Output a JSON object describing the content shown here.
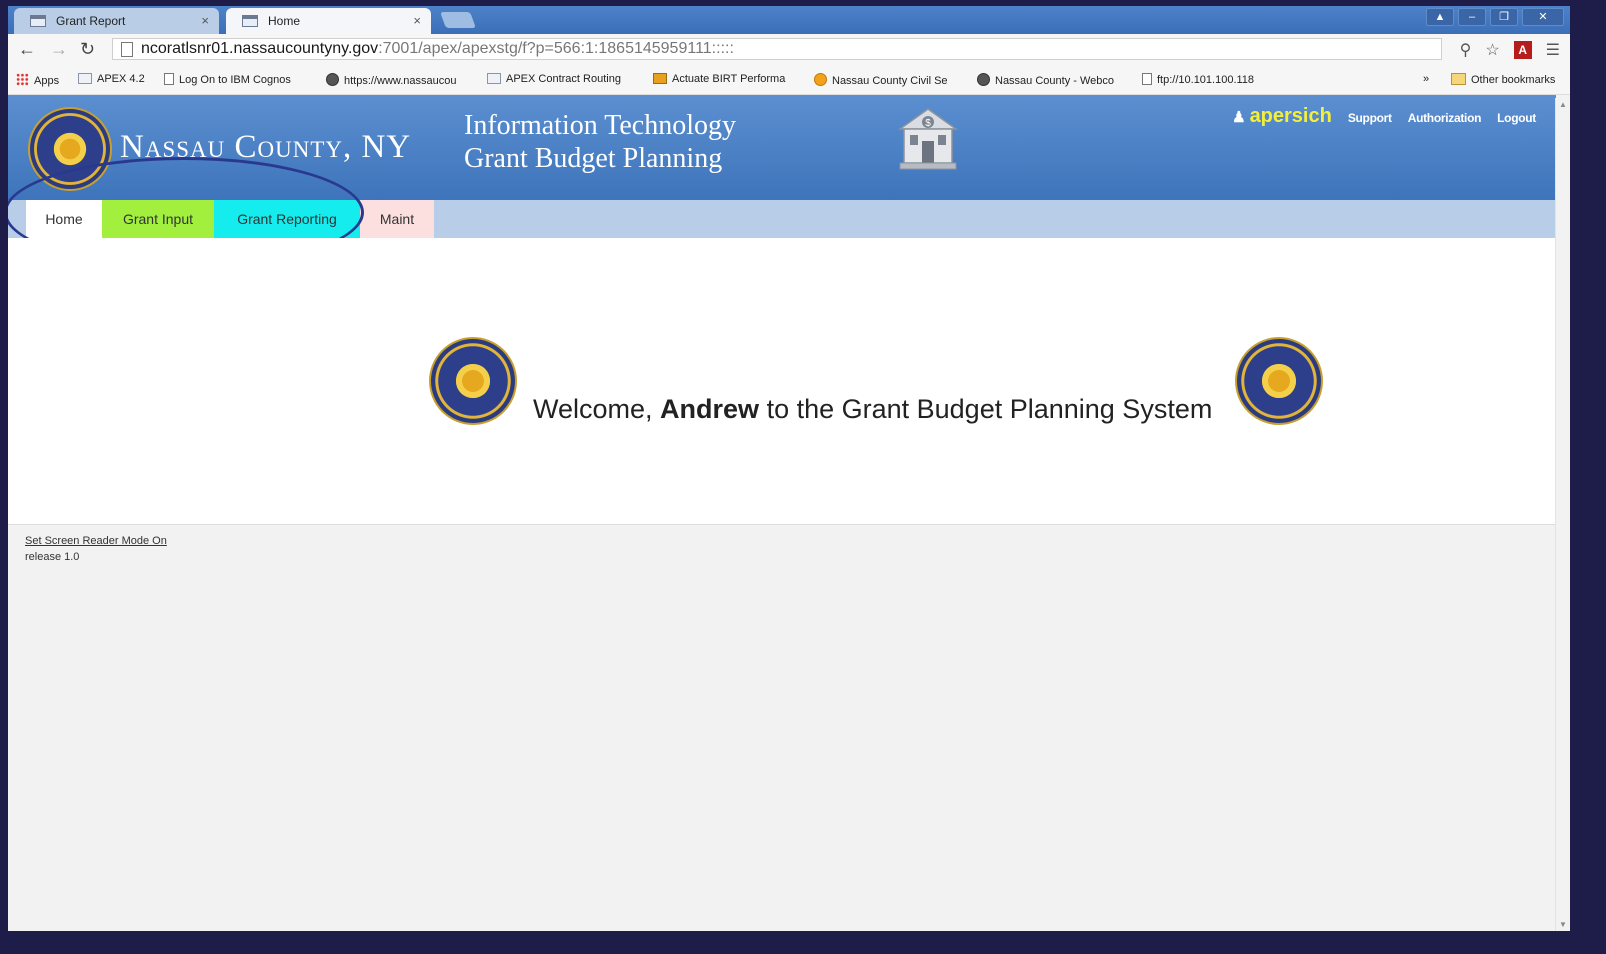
{
  "browser": {
    "tabs": [
      {
        "label": "Grant Report",
        "active": false
      },
      {
        "label": "Home",
        "active": true
      }
    ],
    "tab_close_glyph": "×",
    "window_controls": [
      "▲",
      "–",
      "❐",
      "✕"
    ],
    "url_host": "ncoratlsnr01.nassaucountyny.gov",
    "url_path": ":7001/apex/apexstg/f?p=566:1:1865145959111:::::",
    "bookmarks": [
      {
        "label": "Apps",
        "icon": "apps-icon"
      },
      {
        "label": "APEX 4.2",
        "icon": "window-icon"
      },
      {
        "label": "Log On to IBM Cognos",
        "icon": "page-icon"
      },
      {
        "label": "https://www.nassaucou",
        "icon": "globe-icon"
      },
      {
        "label": "APEX Contract Routing",
        "icon": "window-icon"
      },
      {
        "label": "Actuate BIRT Performa",
        "icon": "birt-icon"
      },
      {
        "label": "Nassau County Civil Se",
        "icon": "civil-service-icon"
      },
      {
        "label": "Nassau County - Webco",
        "icon": "globe-icon"
      },
      {
        "label": "ftp://10.101.100.118",
        "icon": "page-icon"
      }
    ],
    "bookmarks_overflow": "»",
    "other_bookmarks": "Other bookmarks"
  },
  "header": {
    "county_name": "Nassau County, NY",
    "title_line1": "Information Technology",
    "title_line2": "Grant Budget Planning",
    "username": "apersich",
    "links": [
      "Support",
      "Authorization",
      "Logout"
    ]
  },
  "nav": {
    "home": "Home",
    "grant_input": "Grant Input",
    "grant_reporting": "Grant Reporting",
    "maint": "Maint"
  },
  "welcome": {
    "prefix": "Welcome, ",
    "name": "Andrew",
    "suffix": " to the Grant Budget Planning System"
  },
  "footer": {
    "screen_reader_link": "Set Screen Reader Mode On",
    "release": "release 1.0"
  },
  "colors": {
    "header_blue": "#4a80c6",
    "nav_bar": "#b8cde8",
    "grant_input_tab": "#a2ef3e",
    "grant_reporting_tab": "#14ecee",
    "maint_tab": "#fbe0df",
    "username_yellow": "#f5ef3a",
    "annotation_ellipse": "#2a3990"
  }
}
